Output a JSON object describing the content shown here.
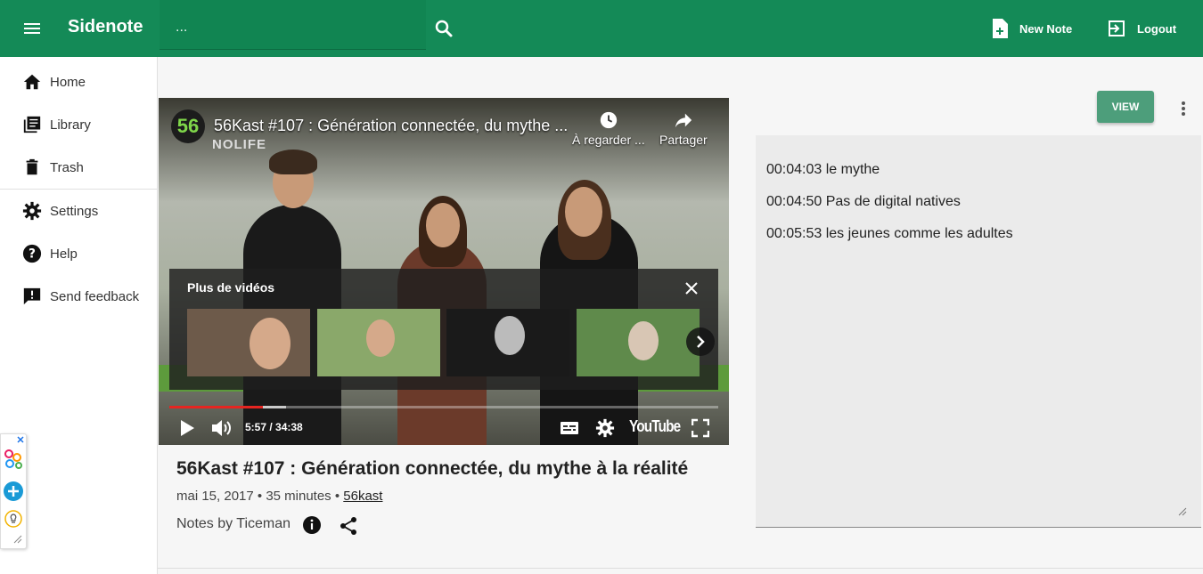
{
  "header": {
    "app_title": "Sidenote",
    "search_placeholder": "...",
    "new_note_label": "New Note",
    "logout_label": "Logout",
    "brand_color": "#148a57"
  },
  "sidebar": {
    "items": [
      {
        "label": "Home",
        "icon": "home-icon"
      },
      {
        "label": "Library",
        "icon": "library-icon"
      },
      {
        "label": "Trash",
        "icon": "trash-icon"
      },
      {
        "label": "Settings",
        "icon": "gear-icon"
      },
      {
        "label": "Help",
        "icon": "help-icon"
      },
      {
        "label": "Send feedback",
        "icon": "feedback-icon"
      }
    ]
  },
  "player": {
    "title": "56Kast #107 : Génération connectée, du mythe ...",
    "channel_badge": "56",
    "watermark": "NOLIFE",
    "watch_later_label": "À regarder ...",
    "share_label": "Partager",
    "more_videos_label": "Plus de vidéos",
    "time_display": "5:57 / 34:38",
    "progress_fraction": 0.17,
    "youtube_label": "YouTube"
  },
  "video_info": {
    "title": "56Kast #107 : Génération connectée, du mythe à la réalité",
    "meta_text": "mai 15, 2017 • 35 minutes • ",
    "channel_link": "56kast",
    "notes_by": "Notes by Ticeman"
  },
  "notes": {
    "view_button": "VIEW",
    "lines": [
      "00:04:03 le mythe",
      "00:04:50 Pas de digital natives",
      "00:05:53 les jeunes comme les adultes"
    ]
  }
}
